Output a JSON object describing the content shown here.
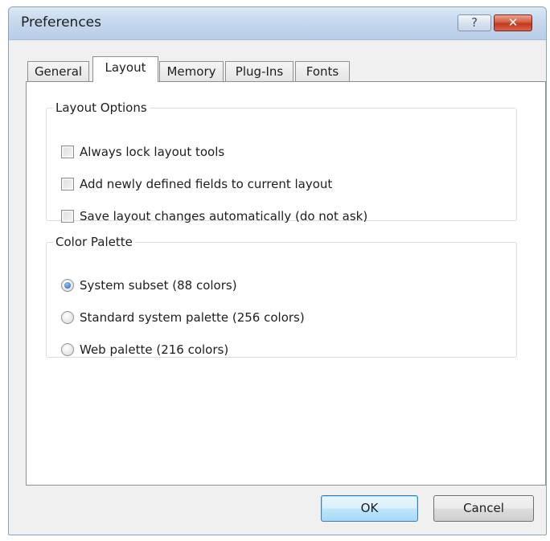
{
  "window": {
    "title": "Preferences",
    "help_label": "?",
    "close_label": "✕"
  },
  "tabs": [
    {
      "label": "General",
      "selected": false
    },
    {
      "label": "Layout",
      "selected": true
    },
    {
      "label": "Memory",
      "selected": false
    },
    {
      "label": "Plug-Ins",
      "selected": false
    },
    {
      "label": "Fonts",
      "selected": false
    }
  ],
  "layout_options": {
    "legend": "Layout Options",
    "items": [
      {
        "label": "Always lock layout tools",
        "checked": false
      },
      {
        "label": "Add newly defined fields to current layout",
        "checked": false
      },
      {
        "label": "Save layout changes automatically (do not ask)",
        "checked": false
      }
    ]
  },
  "color_palette": {
    "legend": "Color Palette",
    "options": [
      {
        "label": "System subset (88 colors)",
        "selected": true
      },
      {
        "label": "Standard system palette (256 colors)",
        "selected": false
      },
      {
        "label": "Web palette (216 colors)",
        "selected": false
      }
    ]
  },
  "buttons": {
    "ok_label": "OK",
    "cancel_label": "Cancel"
  }
}
